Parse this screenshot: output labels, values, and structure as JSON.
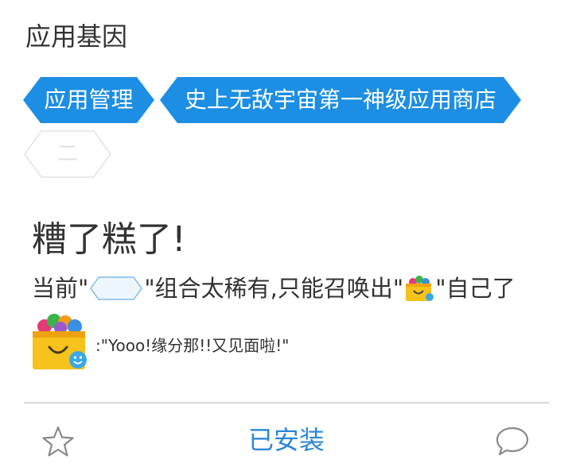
{
  "header": {
    "title": "应用基因"
  },
  "tags": [
    {
      "label": "应用管理"
    },
    {
      "label": "史上无敌宇宙第一神级应用商店"
    },
    {
      "label": "二"
    }
  ],
  "error": {
    "title": "糟了糕了!",
    "message_prefix": "当前\"",
    "message_mid": "\"组合太稀有,只能召唤出\"",
    "message_suffix": "\"自己了",
    "quote": ":\"Yooo!缘分那!!又见面啦!\""
  },
  "bottom_bar": {
    "installed_label": "已安装",
    "favorite_icon": "star-icon",
    "comment_icon": "comment-icon"
  },
  "colors": {
    "accent": "#1c8ee3",
    "installed_text": "#2a86d8",
    "bag_yellow": "#f6c21c"
  }
}
